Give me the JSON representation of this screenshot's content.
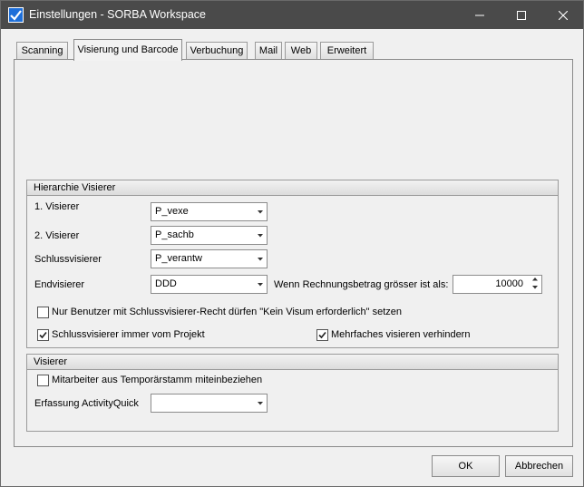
{
  "window": {
    "title": "Einstellungen - SORBA Workspace"
  },
  "tabs": [
    {
      "label": "Scanning"
    },
    {
      "label": "Visierung und Barcode"
    },
    {
      "label": "Verbuchung"
    },
    {
      "label": "Mail"
    },
    {
      "label": "Web"
    },
    {
      "label": "Erweitert"
    }
  ],
  "active_tab": "Visierung und Barcode",
  "hierarchie": {
    "header": "Hierarchie Visierer",
    "visierer1": {
      "label": "1. Visierer",
      "value": "P_vexe"
    },
    "visierer2": {
      "label": "2. Visierer",
      "value": "P_sachb"
    },
    "schlussvisierer": {
      "label": "Schlussvisierer",
      "value": "P_verantw"
    },
    "endvisierer": {
      "label": "Endvisierer",
      "value": "DDD"
    },
    "betrag": {
      "label": "Wenn Rechnungsbetrag grösser ist als:",
      "value": "10000"
    },
    "chk_nur_benutzer": {
      "label": "Nur Benutzer mit Schlussvisierer-Recht dürfen \"Kein Visum erforderlich\" setzen",
      "checked": false
    },
    "chk_schluss_projekt": {
      "label": "Schlussvisierer immer vom Projekt",
      "checked": true
    },
    "chk_mehrfach": {
      "label": "Mehrfaches visieren verhindern",
      "checked": true
    }
  },
  "visierer": {
    "header": "Visierer",
    "chk_mitarbeiter": {
      "label": "Mitarbeiter aus Temporärstamm miteinbeziehen",
      "checked": false
    },
    "activityquick": {
      "label": "Erfassung ActivityQuick",
      "value": ""
    }
  },
  "buttons": {
    "ok": "OK",
    "abbrechen": "Abbrechen"
  },
  "colors": {
    "titlebar": "#4a4a4a",
    "icon_accent": "#1e6fd9"
  }
}
